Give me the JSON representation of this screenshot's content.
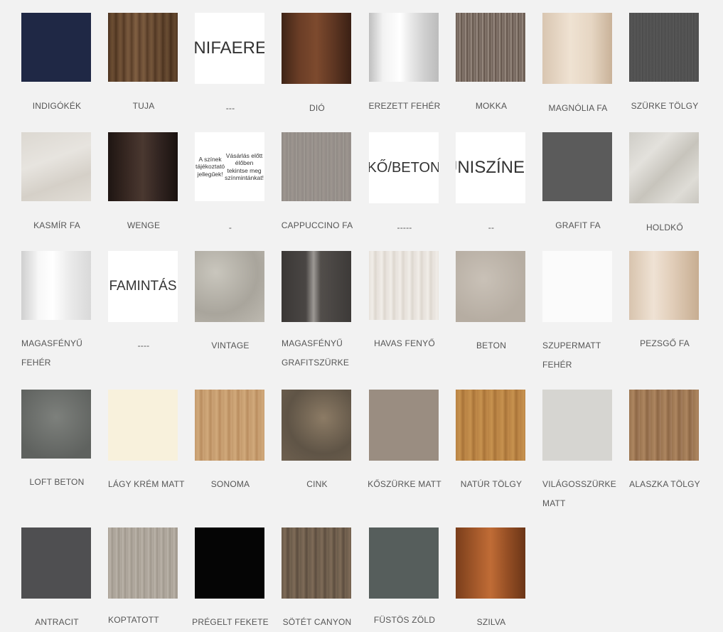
{
  "colors": {
    "page_background": "#f2f2f2",
    "label_text": "#555555",
    "text_tile_background": "#ffffff"
  },
  "rows": [
    {
      "items": [
        {
          "id": "indigokek",
          "label": "INDIGÓKÉK",
          "swatch": "indigo"
        },
        {
          "id": "tuja",
          "label": "TUJA",
          "swatch": "tuja"
        },
        {
          "id": "uni-faeres",
          "label": "---",
          "text": [
            "UNI",
            "FAERES"
          ]
        },
        {
          "id": "dio",
          "label": "DIÓ",
          "swatch": "dio"
        },
        {
          "id": "erezett-feher",
          "label": "EREZETT FEHÉR",
          "swatch": "erezett"
        },
        {
          "id": "mokka",
          "label": "MOKKA",
          "swatch": "mokka"
        },
        {
          "id": "magnolia-fa",
          "label": "MAGNÓLIA FA",
          "swatch": "magnolia"
        },
        {
          "id": "szurke-tolgy",
          "label": "SZÜRKE TÖLGY",
          "swatch": "szurketolgy"
        }
      ]
    },
    {
      "items": [
        {
          "id": "kasmir-fa",
          "label": "KASMÍR FA",
          "swatch": "kasmir"
        },
        {
          "id": "wenge",
          "label": "WENGE",
          "swatch": "wenge"
        },
        {
          "id": "notice",
          "label": "-",
          "notice": [
            "A színek tájékoztató jellegűek!",
            "Vásárlás előtt élőben tekintse meg színmintánkat!"
          ]
        },
        {
          "id": "cappuccino-fa",
          "label": "CAPPUCCINO FA",
          "swatch": "cappuccino"
        },
        {
          "id": "ko-beton",
          "label": "-----",
          "text": [
            "KŐ/BETON"
          ]
        },
        {
          "id": "uni-szinek",
          "label": "--",
          "text": [
            "UNI",
            "SZÍNEK"
          ]
        },
        {
          "id": "grafit-fa",
          "label": "GRAFIT FA",
          "swatch": "grafit"
        },
        {
          "id": "holdko",
          "label": "HOLDKŐ",
          "swatch": "holdko"
        }
      ]
    },
    {
      "items": [
        {
          "id": "magasfenyu-feher",
          "label": "MAGASFÉNYŰ FEHÉR",
          "swatch": "mfeher"
        },
        {
          "id": "famintas",
          "label": "----",
          "text": [
            "FAMINTÁS"
          ]
        },
        {
          "id": "vintage",
          "label": "VINTAGE",
          "swatch": "vintage"
        },
        {
          "id": "magasfenyu-grafitszurke",
          "label": "MAGASFÉNYŰ GRAFITSZÜRKE",
          "swatch": "mgrafit"
        },
        {
          "id": "havas-fenyo",
          "label": "HAVAS FENYŐ",
          "swatch": "havas"
        },
        {
          "id": "beton",
          "label": "BETON",
          "swatch": "beton"
        },
        {
          "id": "szupermatt-feher",
          "label": "SZUPERMATT FEHÉR",
          "swatch": "szupermatt"
        },
        {
          "id": "pezsgo-fa",
          "label": "PEZSGŐ FA",
          "swatch": "pezsgo"
        }
      ]
    },
    {
      "items": [
        {
          "id": "loft-beton",
          "label": "LOFT BETON",
          "swatch": "loft"
        },
        {
          "id": "lagy-krem-matt",
          "label": "LÁGY KRÉM MATT",
          "swatch": "krem"
        },
        {
          "id": "sonoma",
          "label": "SONOMA",
          "swatch": "sonoma"
        },
        {
          "id": "cink",
          "label": "CINK",
          "swatch": "cink"
        },
        {
          "id": "koszurke-matt",
          "label": "KŐSZÜRKE MATT",
          "swatch": "koszurke"
        },
        {
          "id": "natur-tolgy",
          "label": "NATÚR TÖLGY",
          "swatch": "natur"
        },
        {
          "id": "vilagosszurke-matt",
          "label": "VILÁGOSSZÜRKE MATT",
          "swatch": "vilagos"
        },
        {
          "id": "alaszka-tolgy",
          "label": "ALASZKA TÖLGY",
          "swatch": "alaszka"
        }
      ]
    },
    {
      "items": [
        {
          "id": "antracit",
          "label": "ANTRACIT",
          "swatch": "antracit"
        },
        {
          "id": "koptatott",
          "label": "KOPTATOTT",
          "swatch": "koptatott"
        },
        {
          "id": "pregelt-fekete",
          "label": "PRÉGELT FEKETE",
          "swatch": "fekete"
        },
        {
          "id": "sotet-canyon",
          "label": "SÖTÉT CANYON",
          "swatch": "canyon"
        },
        {
          "id": "fustos-zold",
          "label": "FÜSTÖS ZÖLD",
          "swatch": "zold"
        },
        {
          "id": "szilva",
          "label": "SZILVA",
          "swatch": "szilva"
        }
      ]
    }
  ]
}
